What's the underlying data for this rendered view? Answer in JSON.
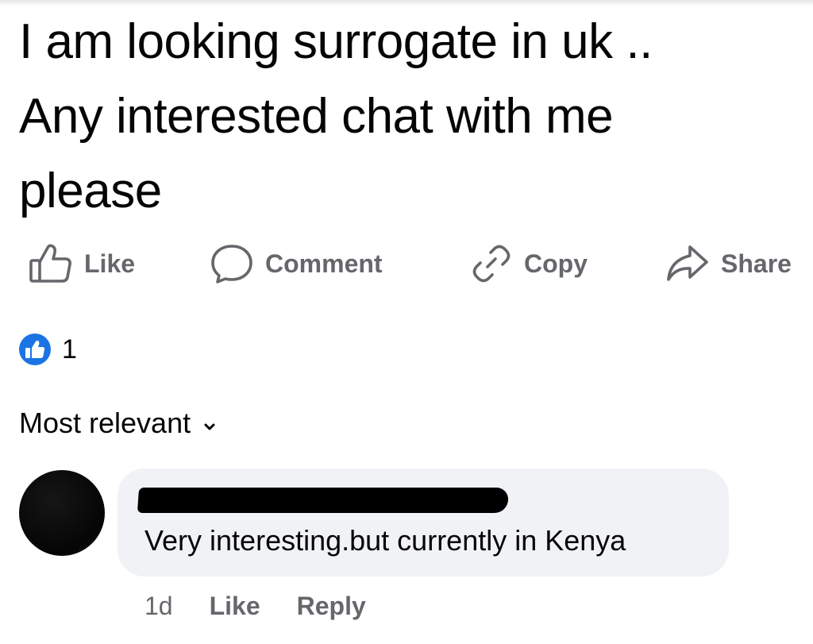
{
  "post": {
    "text_lines": [
      "I am looking surrogate in uk ..",
      "Any interested chat with me",
      "please"
    ]
  },
  "actions": {
    "like_label": "Like",
    "comment_label": "Comment",
    "copy_label": "Copy",
    "share_label": "Share",
    "icons": [
      "thumbs-up-icon",
      "comment-bubble-icon",
      "link-icon",
      "share-arrow-icon"
    ],
    "icon_color": "#65676b"
  },
  "reactions": {
    "count": "1",
    "icon": "like-reaction-icon",
    "badge_color": "#1b74e4"
  },
  "sort": {
    "label": "Most relevant",
    "icon": "chevron-down-icon"
  },
  "comment": {
    "author_redacted": true,
    "text": "Very interesting.but currently in Kenya",
    "time": "1d",
    "like_label": "Like",
    "reply_label": "Reply",
    "bubble_color": "#f0f2f5"
  }
}
